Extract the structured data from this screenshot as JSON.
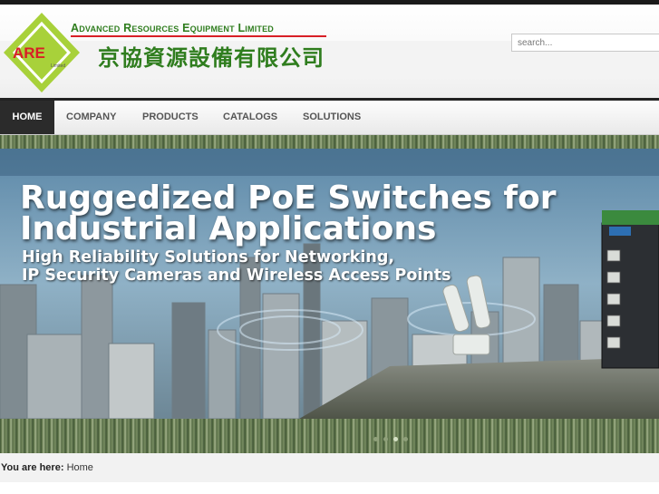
{
  "header": {
    "logo_text": "ARE",
    "logo_subtext": "Limited",
    "company_en": "Advanced Resources Equipment Limited",
    "company_zh": "京協資源設備有限公司",
    "search_placeholder": "search..."
  },
  "nav": {
    "items": [
      {
        "label": "HOME",
        "active": true
      },
      {
        "label": "COMPANY",
        "active": false
      },
      {
        "label": "PRODUCTS",
        "active": false
      },
      {
        "label": "CATALOGS",
        "active": false
      },
      {
        "label": "SOLUTIONS",
        "active": false
      }
    ]
  },
  "banner": {
    "title_line1": "Ruggedized PoE Switches for",
    "title_line2": "Industrial Applications",
    "subtitle_line1": "High Reliability Solutions for Networking,",
    "subtitle_line2": "IP Security Cameras and Wireless Access Points",
    "slide_count": 4,
    "active_slide": 3
  },
  "breadcrumb": {
    "prefix": "You are here:",
    "current": "Home"
  },
  "colors": {
    "brand_green": "#2f7d1e",
    "logo_green": "#a8d13a",
    "logo_red": "#d81f26",
    "nav_active": "#2b2b2b"
  }
}
